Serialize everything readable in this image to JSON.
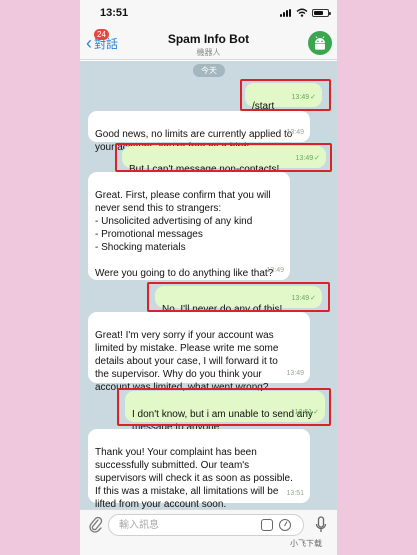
{
  "status_bar": {
    "time": "13:51"
  },
  "header": {
    "back_label": "對話",
    "unread_count": "24",
    "title": "Spam Info Bot",
    "subtitle": "機器人"
  },
  "chat": {
    "date_label": "今天",
    "messages": [
      {
        "dir": "out",
        "text": "/start",
        "time": "13:49"
      },
      {
        "dir": "in",
        "text": "Good news, no limits are currently applied to\nyour account. You're free as a bird!",
        "time": "13:49"
      },
      {
        "dir": "out",
        "text": "But I can't message non-contacts!",
        "time": "13:49"
      },
      {
        "dir": "in",
        "text": "Great. First, please confirm that you will\nnever send this to strangers:\n- Unsolicited advertising of any kind\n- Promotional messages\n- Shocking materials\n\nWere you going to do anything like that?",
        "time": "13:49"
      },
      {
        "dir": "out",
        "text": "No, I'll never do any of this!",
        "time": "13:49"
      },
      {
        "dir": "in",
        "text": "Great! I'm very sorry if your account was\nlimited by mistake. Please write me some\ndetails about your case, I will forward it to\nthe supervisor. Why do you think your\naccount was limited, what went wrong?",
        "time": "13:49"
      },
      {
        "dir": "out",
        "text": "I don't know, but i am unable to send any\nmessage to anyone.",
        "time": "13:51"
      },
      {
        "dir": "in",
        "text": "Thank you! Your complaint has been\nsuccessfully submitted. Our team's\nsupervisors will check it as soon as possible.\nIf this was a mistake, all limitations will be\nlifted from your account soon.",
        "time": "13:51"
      }
    ]
  },
  "input": {
    "placeholder": "輸入訊息"
  },
  "watermark": "小飞下载",
  "colors": {
    "incoming": "#ffffff",
    "outgoing": "#e3f8c9",
    "highlight_frame": "#d9232a",
    "accent": "#2a85d8",
    "page_background": "#efc8de"
  }
}
